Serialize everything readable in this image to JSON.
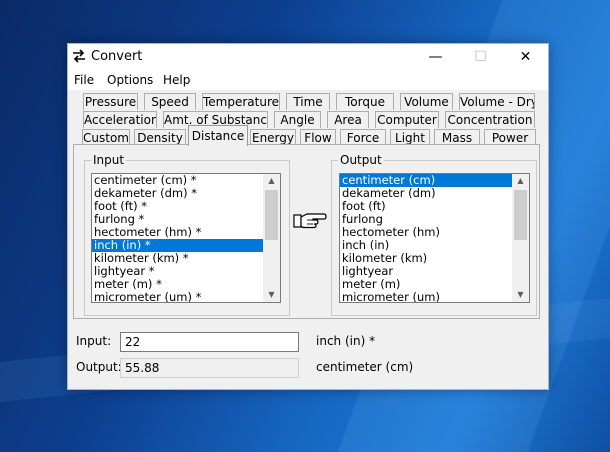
{
  "window": {
    "title": "Convert",
    "minimize_icon": "minimize-icon",
    "maximize_icon": "maximize-icon",
    "close_icon": "close-icon"
  },
  "menu": [
    "File",
    "Options",
    "Help"
  ],
  "tabs": {
    "row1": [
      "Pressure",
      "Speed",
      "Temperature",
      "Time",
      "Torque",
      "Volume",
      "Volume - Dry"
    ],
    "row2": [
      "Acceleration",
      "Amt. of Substance",
      "Angle",
      "Area",
      "Computer",
      "Concentration"
    ],
    "row3": [
      "Custom",
      "Density",
      "Distance",
      "Energy",
      "Flow",
      "Force",
      "Light",
      "Mass",
      "Power"
    ],
    "active": "Distance"
  },
  "input_group": {
    "label": "Input",
    "items": [
      "centimeter (cm) *",
      "dekameter (dm) *",
      "foot (ft) *",
      "furlong *",
      "hectometer (hm) *",
      "inch (in) *",
      "kilometer (km) *",
      "lightyear *",
      "meter (m) *",
      "micrometer (um) *"
    ],
    "selected": "inch (in) *"
  },
  "output_group": {
    "label": "Output",
    "items": [
      "centimeter (cm)",
      "dekameter (dm)",
      "foot (ft)",
      "furlong",
      "hectometer (hm)",
      "inch (in)",
      "kilometer (km)",
      "lightyear",
      "meter (m)",
      "micrometer (um)"
    ],
    "selected": "centimeter (cm)"
  },
  "pointer_icon": "pointing-hand-icon",
  "fields": {
    "input_label": "Input:",
    "input_value": "22",
    "input_unit": "inch (in) *",
    "output_label": "Output:",
    "output_value": "55.88",
    "output_unit": "centimeter (cm)"
  },
  "colors": {
    "selection": "#0078d7",
    "desktop": "#1565c0"
  }
}
